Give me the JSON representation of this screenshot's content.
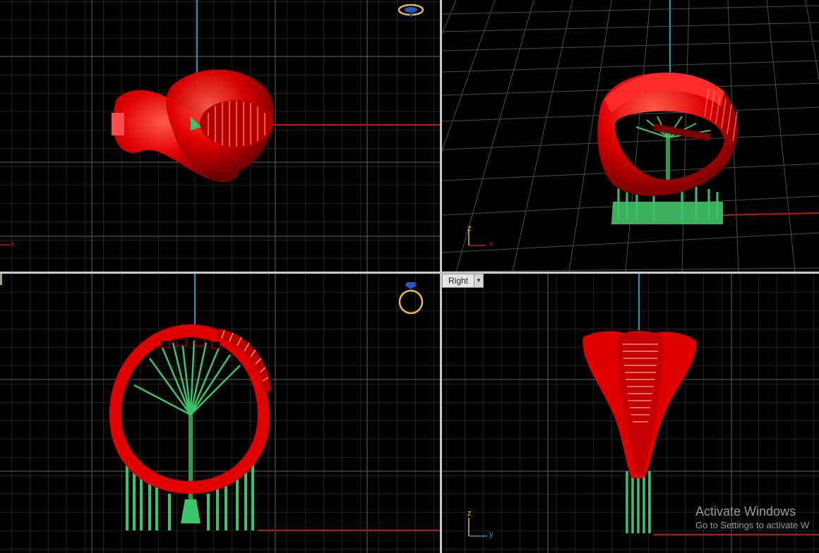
{
  "viewports": {
    "perspective": {
      "axes": {
        "x": "x",
        "z": "z"
      }
    },
    "top": {
      "axes": {
        "x": "x"
      }
    },
    "front": {},
    "right": {
      "label": "Right",
      "axes": {
        "y": "y",
        "z": "z"
      }
    }
  },
  "watermark": {
    "title": "Activate Windows",
    "subtitle": "Go to Settings to activate W"
  },
  "colors": {
    "background": "#000000",
    "grid": "#3a3a3a",
    "grid_major": "#5a5a5a",
    "axis_x": "#c0161b",
    "axis_y": "#1aa0b0",
    "model": "#e00000",
    "support": "#3cc46a",
    "gizmo": "#e8b84a"
  },
  "icons": {
    "top_gizmo": "ring-top-view-icon",
    "front_gizmo": "ring-front-view-icon",
    "dropdown": "chevron-down-icon"
  }
}
